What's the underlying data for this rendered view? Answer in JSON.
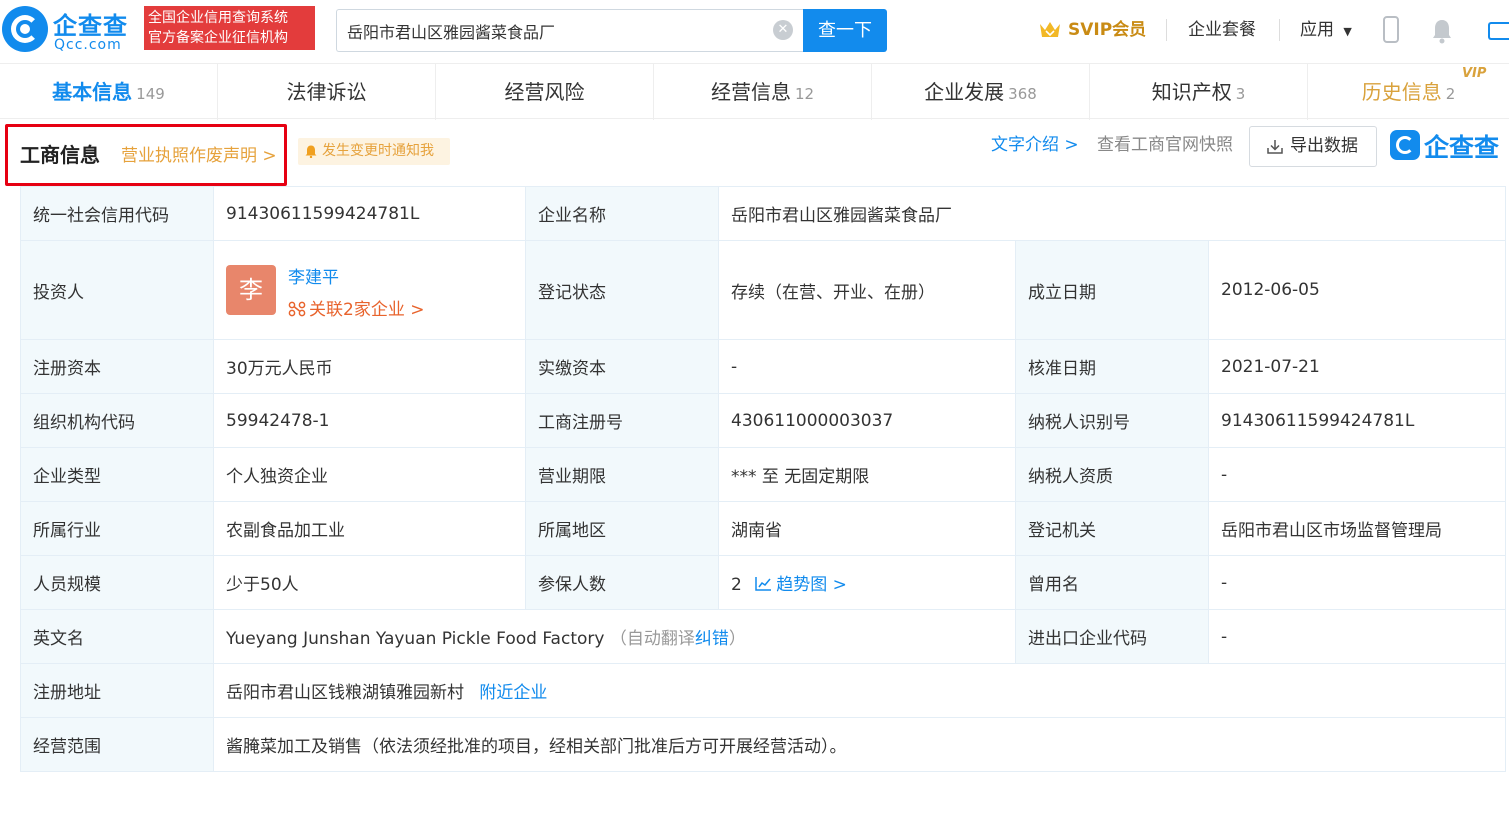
{
  "header": {
    "logo_cn": "企查查",
    "logo_en": "Qcc.com",
    "badge_line1": "全国企业信用查询系统",
    "badge_line2": "官方备案企业征信机构",
    "search_value": "岳阳市君山区雅园酱菜食品厂",
    "search_button": "查一下",
    "svip": "SVIP会员",
    "nav_package": "企业套餐",
    "nav_apps": "应用"
  },
  "tabs": [
    {
      "label": "基本信息",
      "count": "149"
    },
    {
      "label": "法律诉讼",
      "count": ""
    },
    {
      "label": "经营风险",
      "count": ""
    },
    {
      "label": "经营信息",
      "count": "12"
    },
    {
      "label": "企业发展",
      "count": "368"
    },
    {
      "label": "知识产权",
      "count": "3"
    },
    {
      "label": "历史信息",
      "count": "2"
    }
  ],
  "vip_tag": "VIP",
  "section": {
    "title": "工商信息",
    "license_link": "营业执照作废声明 >",
    "notify": "发生变更时通知我",
    "text_intro": "文字介绍 >",
    "snapshot": "查看工商官网快照",
    "export": "导出数据",
    "mini_logo": "企查查"
  },
  "info": {
    "credit_code_label": "统一社会信用代码",
    "credit_code": "91430611599424781L",
    "company_name_label": "企业名称",
    "company_name": "岳阳市君山区雅园酱菜食品厂",
    "investor_label": "投资人",
    "investor_avatar": "李",
    "investor_name": "李建平",
    "investor_related": "关联2家企业 >",
    "status_label": "登记状态",
    "status": "存续（在营、开业、在册）",
    "founded_label": "成立日期",
    "founded": "2012-06-05",
    "reg_capital_label": "注册资本",
    "reg_capital": "30万元人民币",
    "paid_capital_label": "实缴资本",
    "paid_capital": "-",
    "approved_label": "核准日期",
    "approved": "2021-07-21",
    "org_code_label": "组织机构代码",
    "org_code": "59942478-1",
    "reg_no_label": "工商注册号",
    "reg_no": "430611000003037",
    "taxpayer_id_label": "纳税人识别号",
    "taxpayer_id": "91430611599424781L",
    "type_label": "企业类型",
    "type": "个人独资企业",
    "term_label": "营业期限",
    "term": "*** 至 无固定期限",
    "taxpayer_qual_label": "纳税人资质",
    "taxpayer_qual": "-",
    "industry_label": "所属行业",
    "industry": "农副食品加工业",
    "region_label": "所属地区",
    "region": "湖南省",
    "authority_label": "登记机关",
    "authority": "岳阳市君山区市场监督管理局",
    "staff_label": "人员规模",
    "staff": "少于50人",
    "insured_label": "参保人数",
    "insured": "2",
    "trend": "趋势图 >",
    "former_name_label": "曾用名",
    "former_name": "-",
    "english_label": "英文名",
    "english": "Yueyang Junshan Yayuan Pickle Food Factory",
    "auto_translate_open": "（自动翻译",
    "correct": "纠错",
    "auto_translate_close": "）",
    "import_export_label": "进出口企业代码",
    "import_export": "-",
    "address_label": "注册地址",
    "address": "岳阳市君山区钱粮湖镇雅园新村",
    "nearby": "附近企业",
    "scope_label": "经营范围",
    "scope": "酱腌菜加工及销售（依法须经批准的项目，经相关部门批准后方可开展经营活动）。"
  },
  "colors": {
    "brand": "#128bed",
    "badge_red": "#e33c3c",
    "gold": "#c98b14",
    "label_bg": "#f2f9fc",
    "highlight_red": "#e60012"
  }
}
